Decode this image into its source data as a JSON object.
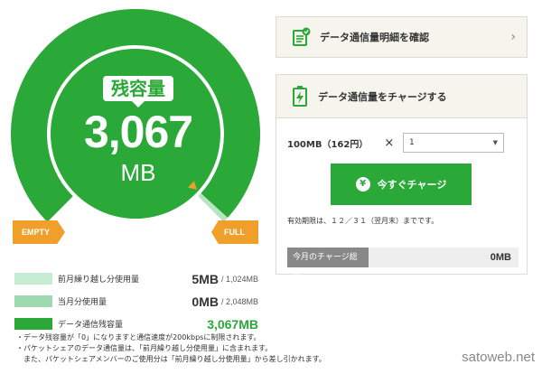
{
  "gauge": {
    "badge_label": "残容量",
    "remaining_value": "3,067",
    "remaining_unit": "MB",
    "empty_label": "EMPTY",
    "full_label": "FULL",
    "fill_fraction": 0.99,
    "colors": {
      "remaining": "#2aa838",
      "used": "#b6e4c4",
      "marker": "#f0a02a"
    }
  },
  "legend": [
    {
      "label": "前月繰り越し分使用量",
      "value": "5MB",
      "total": "/ 1,024MB",
      "color": "#c6ecd4"
    },
    {
      "label": "当月分使用量",
      "value": "0MB",
      "total": "/ 2,048MB",
      "color": "#9ed9b1"
    },
    {
      "label": "データ通信残容量",
      "value": "3,067MB",
      "total": "",
      "color": "#2aa838"
    }
  ],
  "notes": [
    "・データ残容量が「0」になりますと通信速度が200kbpsに制限されます。",
    "・パケットシェアのデータ通信量は、「前月繰り越し分使用量」に含まれます。",
    "　また、パケットシェアメンバーのご使用分は「前月繰り越し分使用量」から差し引かれます。"
  ],
  "detail_panel": {
    "label": "データ通信量明細を確認",
    "icon": "document-check-icon"
  },
  "charge_panel": {
    "title": "データ通信量をチャージする",
    "icon": "battery-charge-icon",
    "plan_label": "100MB（162円）",
    "times_sign": "×",
    "quantity_selected": "1",
    "button_label": "今すぐチャージ",
    "expiry_text": "有効期限は、１２／３１（翌月末）までです。",
    "total_label": "今月のチャージ総量",
    "total_value": "0MB"
  },
  "watermark": "satoweb.net"
}
